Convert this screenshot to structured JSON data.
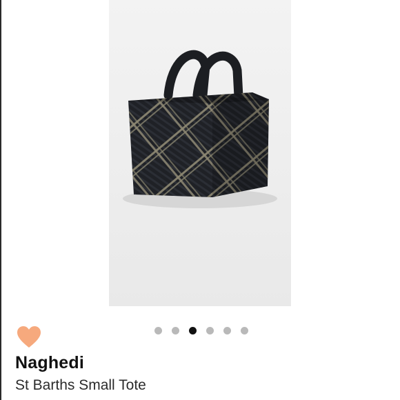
{
  "listing": {
    "image_alt": "Black woven tote bag with tan stripes",
    "carousel": {
      "count": 6,
      "active_index": 2
    },
    "like_icon": "heart-icon",
    "like_color": "#F6A97D",
    "brand": "Naghedi",
    "title": "St Barths Small Tote"
  }
}
